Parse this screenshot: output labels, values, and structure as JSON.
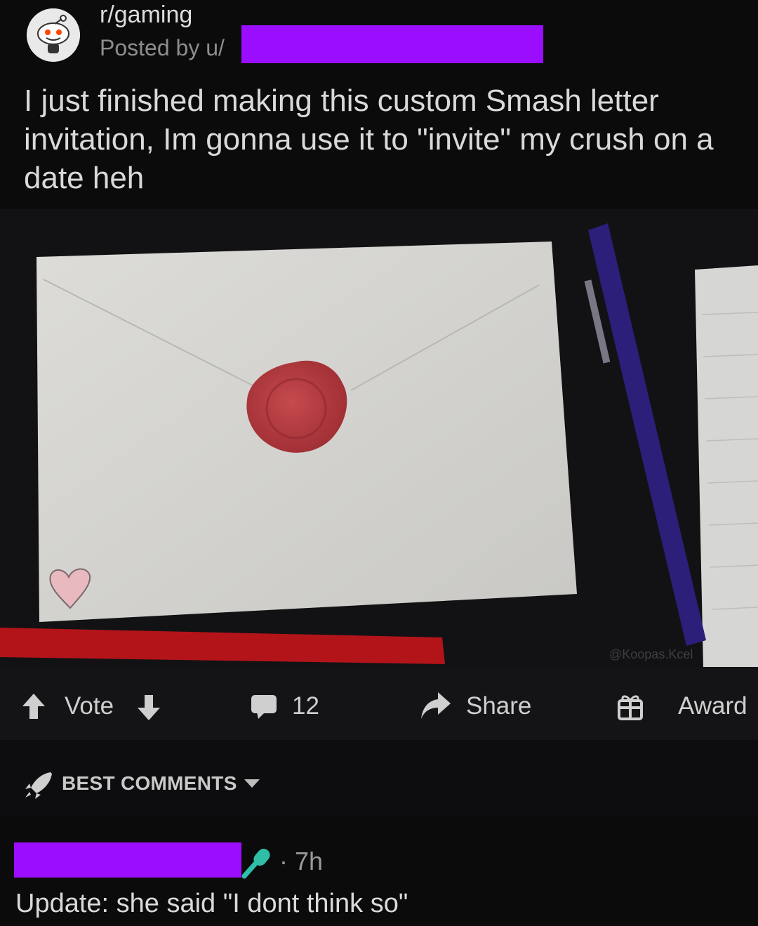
{
  "post": {
    "subreddit": "r/gaming",
    "posted_by_prefix": "Posted by u/",
    "title": "I just finished making this custom Smash letter invitation, Im gonna use it to \"invite\" my crush on a date heh",
    "image_watermark": "@Koopas.Kcel"
  },
  "actions": {
    "vote_label": "Vote",
    "comment_count": "12",
    "share_label": "Share",
    "award_label": "Award"
  },
  "comments_header": {
    "sort_label": "BEST COMMENTS"
  },
  "comment": {
    "time": "· 7h",
    "body": "Update: she said \"I dont think so\""
  },
  "colors": {
    "redaction": "#9b0dff",
    "background": "#0b0b0c",
    "mic_badge": "#2fbfa8"
  },
  "icons": [
    "subreddit-avatar-icon",
    "upvote-icon",
    "downvote-icon",
    "comment-icon",
    "share-icon",
    "award-icon",
    "rocket-icon",
    "chevron-down-icon",
    "microphone-icon"
  ]
}
